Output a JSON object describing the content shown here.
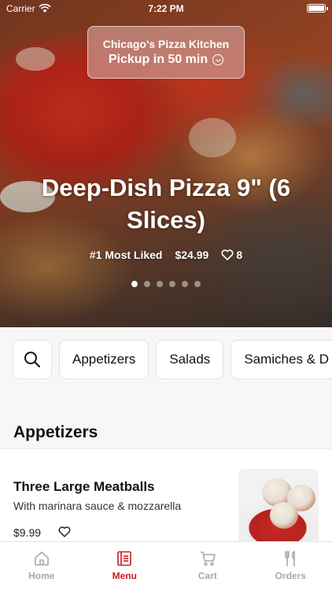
{
  "status_bar": {
    "carrier": "Carrier",
    "time": "7:22 PM"
  },
  "pickup": {
    "restaurant": "Chicago's Pizza Kitchen",
    "label": "Pickup in 50 min"
  },
  "featured": {
    "title": "Deep-Dish Pizza 9\" (6 Slices)",
    "badge": "#1 Most Liked",
    "price": "$24.99",
    "likes": "8",
    "pages": 6,
    "active_page": 0
  },
  "categories": [
    "Appetizers",
    "Salads",
    "Samiches & D"
  ],
  "section": {
    "title": "Appetizers"
  },
  "items": [
    {
      "name": "Three Large Meatballs",
      "description": "With marinara sauce & mozzarella",
      "price": "$9.99"
    }
  ],
  "tabs": [
    {
      "label": "Home",
      "icon": "home-icon",
      "active": false
    },
    {
      "label": "Menu",
      "icon": "menu-icon",
      "active": true
    },
    {
      "label": "Cart",
      "icon": "cart-icon",
      "active": false
    },
    {
      "label": "Orders",
      "icon": "orders-icon",
      "active": false
    }
  ],
  "colors": {
    "accent": "#cf1b22",
    "inactive_tab": "#a8a8a8"
  }
}
